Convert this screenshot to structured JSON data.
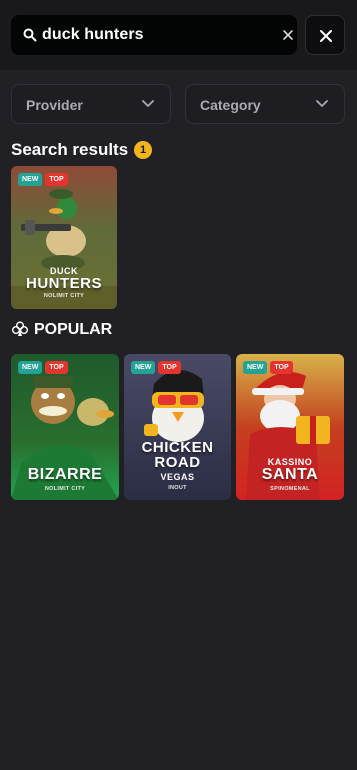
{
  "search": {
    "value": "duck hunters",
    "icon": "search-icon",
    "clear_icon": "close-icon"
  },
  "close_button": {
    "icon": "close-icon"
  },
  "filters": {
    "provider": "Provider",
    "category": "Category"
  },
  "results": {
    "title": "Search results",
    "count": "1",
    "games": [
      {
        "pre": "DUCK",
        "title": "HUNTERS",
        "provider": "NOLIMIT CITY",
        "badges": [
          "NEW",
          "TOP"
        ]
      }
    ]
  },
  "popular": {
    "title": "POPULAR",
    "icon": "club-icon",
    "games": [
      {
        "title": "BIZARRE",
        "provider": "NOLIMIT CITY",
        "badges": [
          "NEW",
          "TOP"
        ]
      },
      {
        "title": "CHICKEN",
        "title2": "ROAD",
        "subtitle": "VEGAS",
        "provider": "INOUT",
        "badges": [
          "NEW",
          "TOP"
        ]
      },
      {
        "pre": "KASSINO",
        "title": "SANTA",
        "provider": "SPINOMENAL",
        "badges": [
          "NEW",
          "TOP"
        ]
      }
    ]
  },
  "colors": {
    "background": "#212125",
    "header": "#19191c",
    "count_badge": "#f2b51f",
    "badge_new": "#23a396",
    "badge_top": "#e3342d"
  }
}
